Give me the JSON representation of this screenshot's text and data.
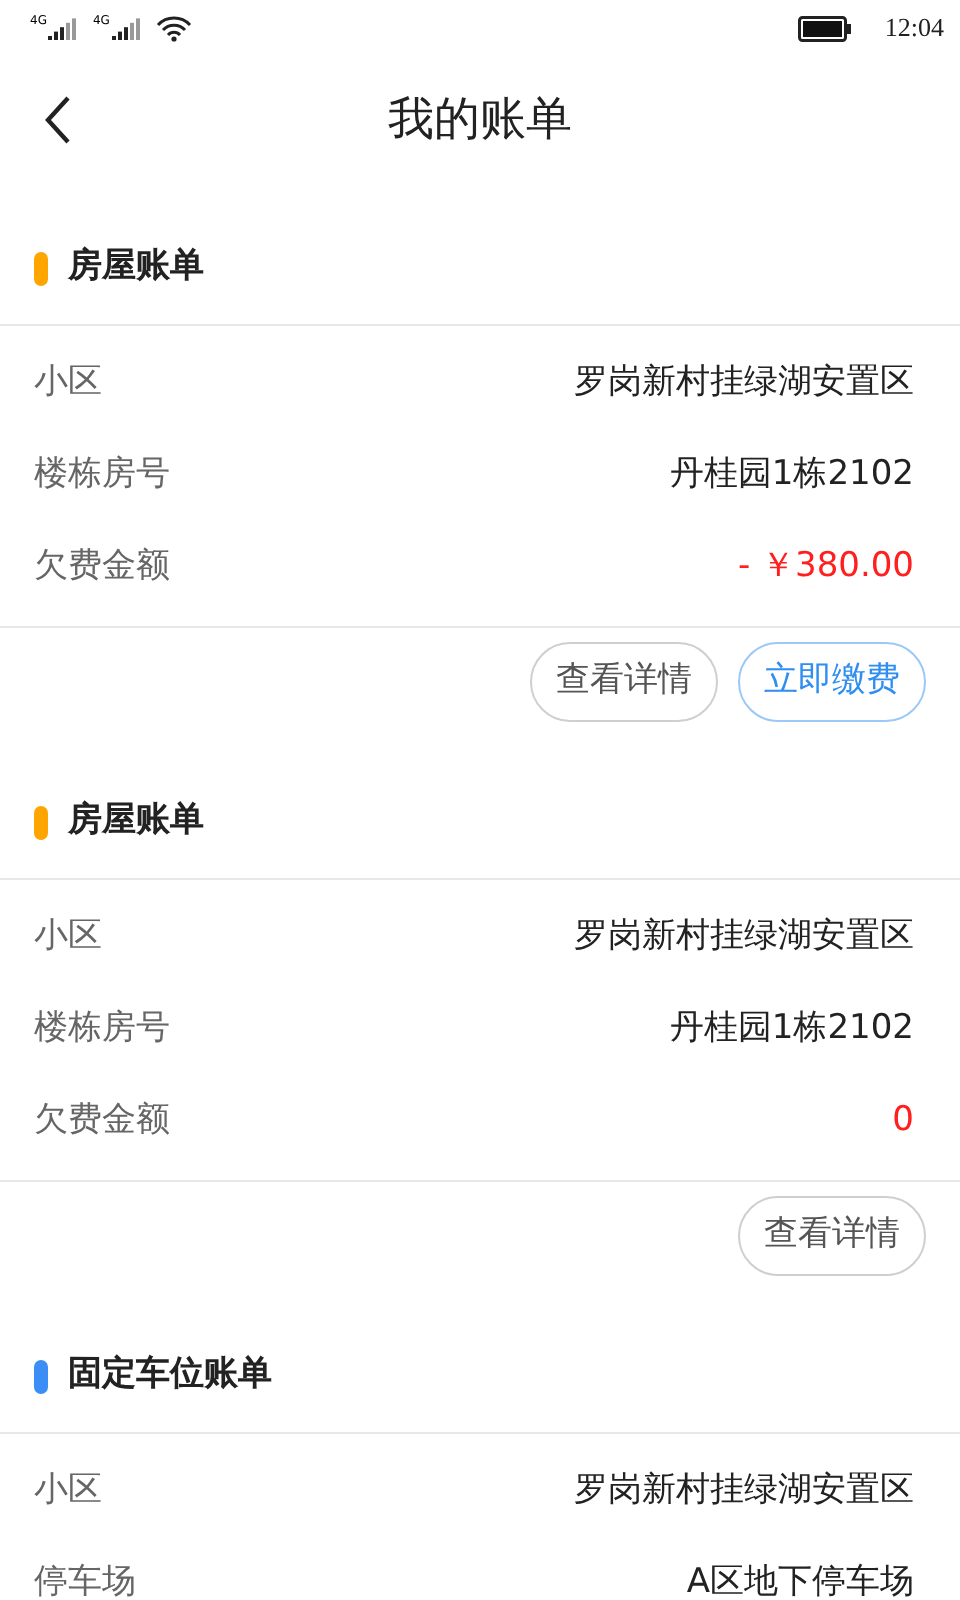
{
  "status_bar": {
    "network_1": "4G",
    "network_2": "4G",
    "time": "12:04"
  },
  "header": {
    "title": "我的账单"
  },
  "bills": [
    {
      "title": "房屋账单",
      "color": "#ffa500",
      "rows": [
        {
          "kind": "text",
          "label": "小区",
          "value": "罗岗新村挂绿湖安置区"
        },
        {
          "kind": "text",
          "label": "楼栋房号",
          "value": "丹桂园1栋2102"
        },
        {
          "kind": "amount",
          "label": "欠费金额",
          "value": "- ￥380.00"
        }
      ],
      "buttons": [
        {
          "kind": "secondary",
          "label": "查看详情"
        },
        {
          "kind": "primary",
          "label": "立即缴费"
        }
      ]
    },
    {
      "title": "房屋账单",
      "color": "#ffa500",
      "rows": [
        {
          "kind": "text",
          "label": "小区",
          "value": "罗岗新村挂绿湖安置区"
        },
        {
          "kind": "text",
          "label": "楼栋房号",
          "value": "丹桂园1栋2102"
        },
        {
          "kind": "amount",
          "label": "欠费金额",
          "value": "0"
        }
      ],
      "buttons": [
        {
          "kind": "secondary",
          "label": "查看详情"
        }
      ]
    },
    {
      "title": "固定车位账单",
      "color": "#3b8ef5",
      "rows": [
        {
          "kind": "text",
          "label": "小区",
          "value": "罗岗新村挂绿湖安置区"
        },
        {
          "kind": "text",
          "label": "停车场",
          "value": "A区地下停车场"
        }
      ]
    }
  ]
}
